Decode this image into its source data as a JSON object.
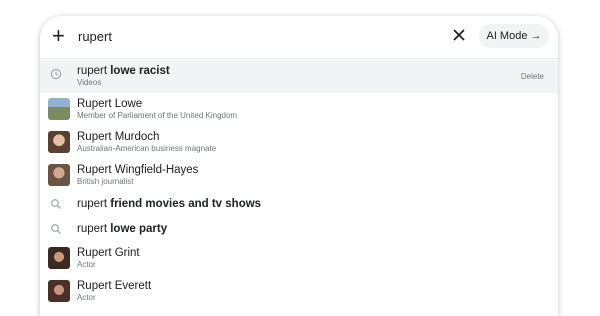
{
  "search": {
    "query": "rupert",
    "ai_mode_label": "AI Mode →"
  },
  "suggestions": [
    {
      "type": "history",
      "prefix": "rupert",
      "bold": " lowe racist",
      "sub": "Videos",
      "action": "Delete"
    },
    {
      "type": "entity",
      "title": "Rupert Lowe",
      "sub": "Member of Parliament of the United Kingdom",
      "thumb_color": "#6f8ea6"
    },
    {
      "type": "entity",
      "title": "Rupert Murdoch",
      "sub": "Australian-American business magnate",
      "thumb_color": "#b08a6a"
    },
    {
      "type": "entity",
      "title": "Rupert Wingfield-Hayes",
      "sub": "British journalist",
      "thumb_color": "#8a6e58"
    },
    {
      "type": "search",
      "prefix": "rupert",
      "bold": " friend movies and tv shows"
    },
    {
      "type": "search",
      "prefix": "rupert",
      "bold": " lowe party"
    },
    {
      "type": "entity",
      "title": "Rupert Grint",
      "sub": "Actor",
      "thumb_color": "#7a5a3e"
    },
    {
      "type": "entity",
      "title": "Rupert Everett",
      "sub": "Actor",
      "thumb_color": "#6a4a3a"
    }
  ]
}
